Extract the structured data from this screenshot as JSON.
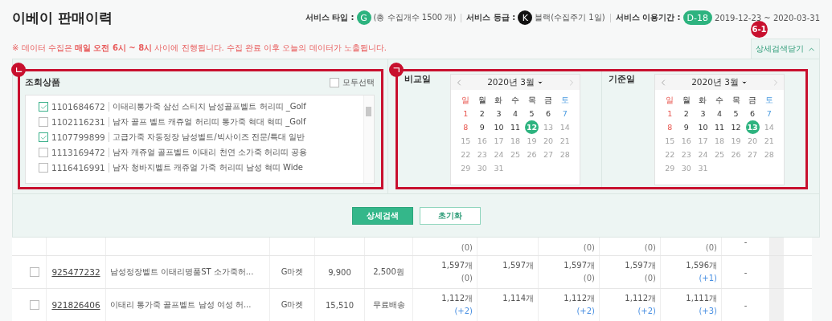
{
  "header": {
    "title": "이베이 판매이력",
    "info": [
      {
        "label": "서비스 타입 :",
        "badge": "G",
        "kind": "circle",
        "color": "#2db37f",
        "text": "(총 수집개수 1500 개)"
      },
      {
        "label": "서비스 등급 :",
        "badge": "K",
        "kind": "circle",
        "color": "#111111",
        "text": "블랙(수집주기 1일)"
      },
      {
        "label": "서비스 이용기간 :",
        "badge": "D-18",
        "kind": "pill",
        "color": "#2db37f",
        "text": "2019-12-23 ~ 2020-03-31"
      }
    ]
  },
  "notice": "※ 데이터 수집은 **매일 오전 6시 ~ 8시** 사이에 진행됩니다. 수집 완료 이후 오늘의 데이터가 노출됩니다.",
  "detail_toggle": {
    "label": "상세검색닫기",
    "expanded": true,
    "marker": "6-1"
  },
  "product_panel": {
    "marker": "ㄴ",
    "title": "조회상품",
    "select_all": {
      "label": "모두선택",
      "checked": false
    },
    "items": [
      {
        "id": "1101684672",
        "name": "이태리통가죽 삼선 스티치 남성골프벨트 허리띠 _Golf",
        "checked": true
      },
      {
        "id": "1102116231",
        "name": "남자 골프 벨트 캐쥬얼 허리띠 통가죽 혁대 혁띠 _Golf",
        "checked": false
      },
      {
        "id": "1107799899",
        "name": "고급가죽 자동정장 남성벨트/빅사이즈 전문/특대 일반",
        "checked": true
      },
      {
        "id": "1113169472",
        "name": "남자 캐쥬얼 골프벨트 이태리 천연 소가죽 허리띠 공용",
        "checked": false
      },
      {
        "id": "1116416991",
        "name": "남자 청바지벨트 캐쥬얼 가죽 허리띠 남성 혁띠 Wide",
        "checked": false
      }
    ]
  },
  "date_panel": {
    "marker": "ㄱ",
    "pickers": [
      {
        "label": "비교일",
        "month": "2020년 3월",
        "weekdays": [
          "일",
          "월",
          "화",
          "수",
          "목",
          "금",
          "토"
        ],
        "days": [
          {
            "day": "1",
            "selected": false,
            "disabled": false
          },
          {
            "day": "2",
            "selected": false,
            "disabled": false
          },
          {
            "day": "3",
            "selected": false,
            "disabled": false
          },
          {
            "day": "4",
            "selected": false,
            "disabled": false
          },
          {
            "day": "5",
            "selected": false,
            "disabled": false
          },
          {
            "day": "6",
            "selected": false,
            "disabled": false
          },
          {
            "day": "7",
            "selected": false,
            "disabled": false
          },
          {
            "day": "8",
            "selected": false,
            "disabled": false
          },
          {
            "day": "9",
            "selected": false,
            "disabled": false
          },
          {
            "day": "10",
            "selected": false,
            "disabled": false
          },
          {
            "day": "11",
            "selected": false,
            "disabled": false
          },
          {
            "day": "12",
            "selected": true,
            "disabled": false
          },
          {
            "day": "13",
            "selected": false,
            "disabled": true
          },
          {
            "day": "14",
            "selected": false,
            "disabled": true
          },
          {
            "day": "15",
            "selected": false,
            "disabled": true
          },
          {
            "day": "16",
            "selected": false,
            "disabled": true
          },
          {
            "day": "17",
            "selected": false,
            "disabled": true
          },
          {
            "day": "18",
            "selected": false,
            "disabled": true
          },
          {
            "day": "19",
            "selected": false,
            "disabled": true
          },
          {
            "day": "20",
            "selected": false,
            "disabled": true
          },
          {
            "day": "21",
            "selected": false,
            "disabled": true
          },
          {
            "day": "22",
            "selected": false,
            "disabled": true
          },
          {
            "day": "23",
            "selected": false,
            "disabled": true
          },
          {
            "day": "24",
            "selected": false,
            "disabled": true
          },
          {
            "day": "25",
            "selected": false,
            "disabled": true
          },
          {
            "day": "26",
            "selected": false,
            "disabled": true
          },
          {
            "day": "27",
            "selected": false,
            "disabled": true
          },
          {
            "day": "28",
            "selected": false,
            "disabled": true
          },
          {
            "day": "29",
            "selected": false,
            "disabled": true
          },
          {
            "day": "30",
            "selected": false,
            "disabled": true
          },
          {
            "day": "31",
            "selected": false,
            "disabled": true
          }
        ]
      },
      {
        "label": "기준일",
        "month": "2020년 3월",
        "weekdays": [
          "일",
          "월",
          "화",
          "수",
          "목",
          "금",
          "토"
        ],
        "days": [
          {
            "day": "1",
            "selected": false,
            "disabled": false
          },
          {
            "day": "2",
            "selected": false,
            "disabled": false
          },
          {
            "day": "3",
            "selected": false,
            "disabled": false
          },
          {
            "day": "4",
            "selected": false,
            "disabled": false
          },
          {
            "day": "5",
            "selected": false,
            "disabled": false
          },
          {
            "day": "6",
            "selected": false,
            "disabled": false
          },
          {
            "day": "7",
            "selected": false,
            "disabled": false
          },
          {
            "day": "8",
            "selected": false,
            "disabled": false
          },
          {
            "day": "9",
            "selected": false,
            "disabled": false
          },
          {
            "day": "10",
            "selected": false,
            "disabled": false
          },
          {
            "day": "11",
            "selected": false,
            "disabled": false
          },
          {
            "day": "12",
            "selected": false,
            "disabled": false
          },
          {
            "day": "13",
            "selected": true,
            "disabled": false
          },
          {
            "day": "14",
            "selected": false,
            "disabled": true
          },
          {
            "day": "15",
            "selected": false,
            "disabled": true
          },
          {
            "day": "16",
            "selected": false,
            "disabled": true
          },
          {
            "day": "17",
            "selected": false,
            "disabled": true
          },
          {
            "day": "18",
            "selected": false,
            "disabled": true
          },
          {
            "day": "19",
            "selected": false,
            "disabled": true
          },
          {
            "day": "20",
            "selected": false,
            "disabled": true
          },
          {
            "day": "21",
            "selected": false,
            "disabled": true
          },
          {
            "day": "22",
            "selected": false,
            "disabled": true
          },
          {
            "day": "23",
            "selected": false,
            "disabled": true
          },
          {
            "day": "24",
            "selected": false,
            "disabled": true
          },
          {
            "day": "25",
            "selected": false,
            "disabled": true
          },
          {
            "day": "26",
            "selected": false,
            "disabled": true
          },
          {
            "day": "27",
            "selected": false,
            "disabled": true
          },
          {
            "day": "28",
            "selected": false,
            "disabled": true
          },
          {
            "day": "29",
            "selected": false,
            "disabled": true
          },
          {
            "day": "30",
            "selected": false,
            "disabled": true
          },
          {
            "day": "31",
            "selected": false,
            "disabled": true
          }
        ]
      }
    ]
  },
  "buttons": [
    {
      "label": "상세검색",
      "kind": "primary"
    },
    {
      "label": "초기화",
      "kind": "secondary"
    }
  ],
  "table": {
    "rows": [
      {
        "partial": true,
        "stock_1": {
          "change": "(0)",
          "color": "#777777"
        },
        "stock_3": {
          "change": "(0)",
          "color": "#777777"
        },
        "stock_4": {
          "change": "(0)",
          "color": "#777777"
        },
        "stock_5": {
          "change": "(0)",
          "color": "#777777"
        },
        "last": "-"
      },
      {
        "partial": false,
        "checked": false,
        "product_id": "925477232",
        "name": "남성정장벨트 이태리명품ST 소가죽허...",
        "market": "G마켓",
        "price": "9,900",
        "shipping": "2,500원",
        "stock_1": {
          "count": "1,597개",
          "change": "(0)",
          "color": "#777777"
        },
        "stock_2": {
          "count": "1,597개"
        },
        "stock_3": {
          "count": "1,597개",
          "change": "(0)",
          "color": "#777777"
        },
        "stock_4": {
          "count": "1,597개",
          "change": "(0)",
          "color": "#777777"
        },
        "stock_5": {
          "count": "1,596개",
          "change": "(+1)",
          "color": "#4a90e2"
        },
        "last": "-"
      },
      {
        "partial": false,
        "checked": false,
        "product_id": "921826406",
        "name": "이태리 통가죽 골프벨트 남성 여성 허...",
        "market": "G마켓",
        "price": "15,510",
        "shipping": "무료배송",
        "stock_1": {
          "count": "1,112개",
          "change": "(+2)",
          "color": "#4a90e2"
        },
        "stock_2": {
          "count": "1,114개"
        },
        "stock_3": {
          "count": "1,112개",
          "change": "(+2)",
          "color": "#4a90e2"
        },
        "stock_4": {
          "count": "1,112개",
          "change": "(+2)",
          "color": "#4a90e2"
        },
        "stock_5": {
          "count": "1,111개",
          "change": "(+3)",
          "color": "#4a90e2"
        },
        "last": "-"
      }
    ]
  }
}
